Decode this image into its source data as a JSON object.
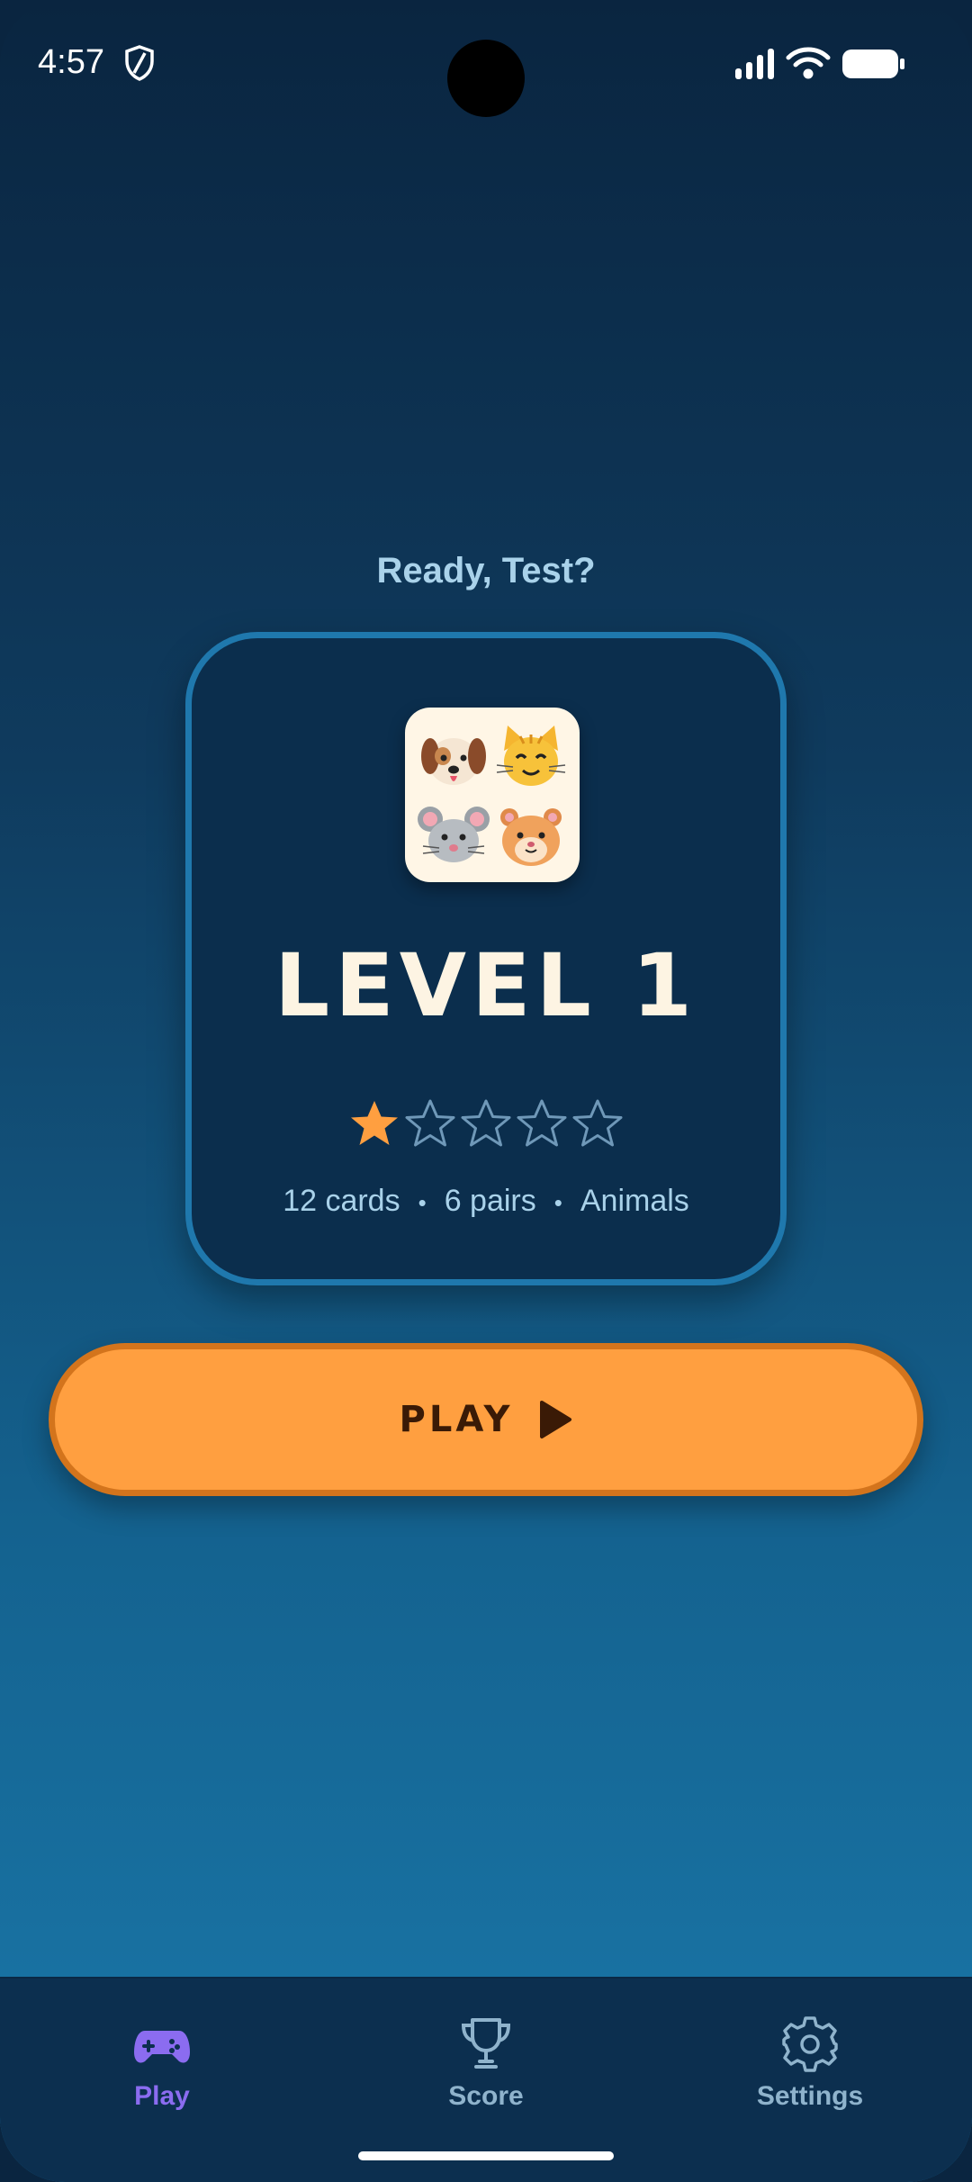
{
  "status_bar": {
    "time": "4:57"
  },
  "greeting": "Ready, Test?",
  "level_card": {
    "title": "LEVEL 1",
    "rating": {
      "filled": 1,
      "total": 5
    },
    "cards": "12 cards",
    "pairs": "6 pairs",
    "category": "Animals",
    "separator": "•",
    "thumbnail_icons": [
      "dog-face-icon",
      "cat-face-icon",
      "mouse-face-icon",
      "hamster-face-icon"
    ]
  },
  "play_button": {
    "label": "PLAY",
    "icon": "play-triangle-icon"
  },
  "bottom_nav": {
    "items": [
      {
        "label": "Play",
        "icon": "gamepad-icon",
        "active": true
      },
      {
        "label": "Score",
        "icon": "trophy-icon",
        "active": false
      },
      {
        "label": "Settings",
        "icon": "gear-icon",
        "active": false
      }
    ]
  },
  "colors": {
    "accent_orange": "#ff9f40",
    "star_filled": "#ff9f40",
    "nav_active": "#8b6cf0",
    "nav_inactive": "#8fb3cc",
    "card_border": "#1f78ad"
  }
}
